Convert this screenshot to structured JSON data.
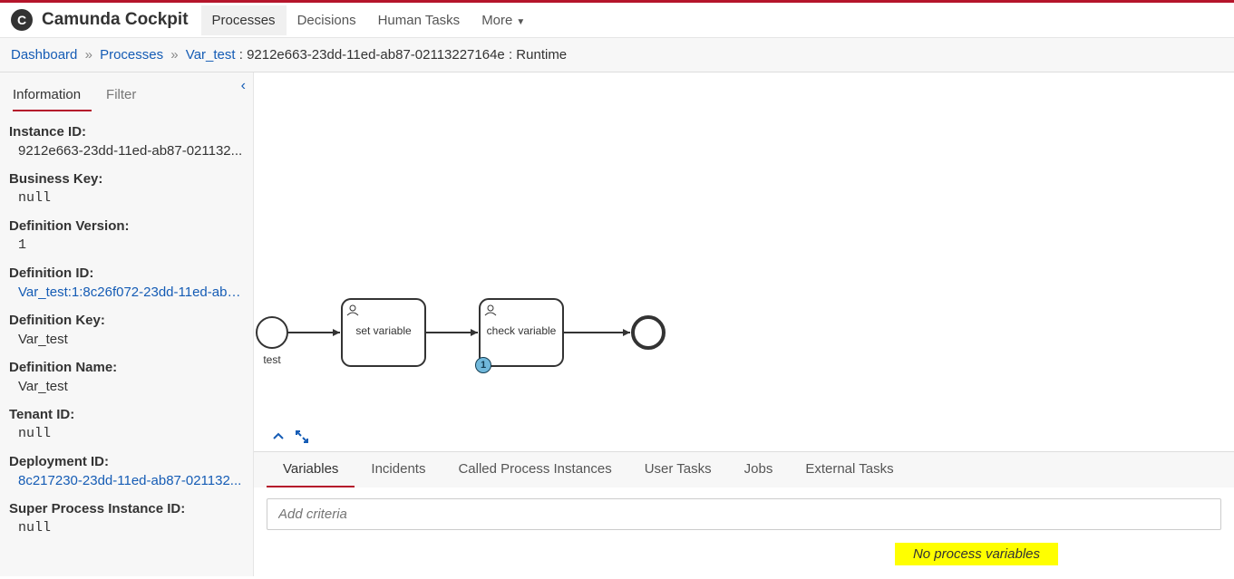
{
  "header": {
    "app_title": "Camunda Cockpit",
    "nav": {
      "processes": "Processes",
      "decisions": "Decisions",
      "human_tasks": "Human Tasks",
      "more": "More"
    }
  },
  "breadcrumb": {
    "dashboard": "Dashboard",
    "processes": "Processes",
    "process_name": "Var_test",
    "instance_id": "9212e663-23dd-11ed-ab87-02113227164e",
    "view": "Runtime"
  },
  "sidebar": {
    "tabs": {
      "information": "Information",
      "filter": "Filter"
    },
    "props": {
      "instance_id_label": "Instance ID:",
      "instance_id_value": "9212e663-23dd-11ed-ab87-021132...",
      "business_key_label": "Business Key:",
      "business_key_value": "null",
      "def_version_label": "Definition Version:",
      "def_version_value": "1",
      "def_id_label": "Definition ID:",
      "def_id_value": "Var_test:1:8c26f072-23dd-11ed-ab8...",
      "def_key_label": "Definition Key:",
      "def_key_value": "Var_test",
      "def_name_label": "Definition Name:",
      "def_name_value": "Var_test",
      "tenant_id_label": "Tenant ID:",
      "tenant_id_value": "null",
      "deployment_id_label": "Deployment ID:",
      "deployment_id_value": "8c217230-23dd-11ed-ab87-021132...",
      "super_proc_label": "Super Process Instance ID:",
      "super_proc_value": "null"
    }
  },
  "diagram": {
    "start_label": "test",
    "task1_label": "set variable",
    "task2_label": "check variable",
    "token_count": "1"
  },
  "bottom": {
    "tabs": {
      "variables": "Variables",
      "incidents": "Incidents",
      "called": "Called Process Instances",
      "user_tasks": "User Tasks",
      "jobs": "Jobs",
      "external": "External Tasks"
    },
    "criteria_placeholder": "Add criteria",
    "no_variables": "No process variables"
  }
}
